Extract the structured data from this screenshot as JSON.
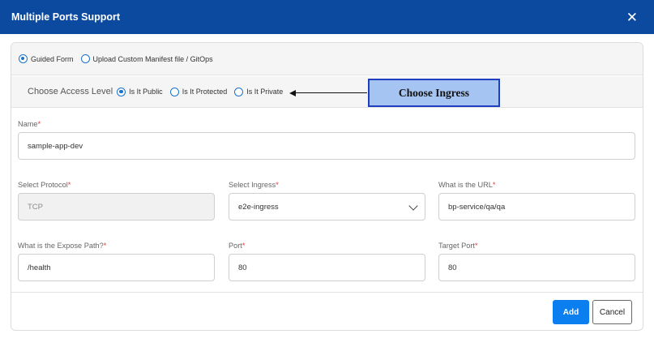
{
  "dialog": {
    "title": "Multiple Ports Support",
    "close_symbol": "✕"
  },
  "mode_options": [
    {
      "label": "Guided Form",
      "checked": true
    },
    {
      "label": "Upload Custom Manifest file / GitOps",
      "checked": false
    }
  ],
  "access": {
    "label": "Choose Access Level",
    "options": [
      {
        "label": "Is It Public",
        "checked": true
      },
      {
        "label": "Is It Protected",
        "checked": false
      },
      {
        "label": "Is It Private",
        "checked": false
      }
    ]
  },
  "annotation": {
    "text": "Choose Ingress"
  },
  "fields": {
    "name": {
      "label": "Name",
      "required_mark": "*",
      "value": "sample-app-dev"
    },
    "protocol": {
      "label": "Select Protocol",
      "required_mark": "*",
      "value": "TCP"
    },
    "ingress": {
      "label": "Select Ingress",
      "required_mark": "*",
      "value": "e2e-ingress"
    },
    "url": {
      "label": "What is the URL",
      "required_mark": "*",
      "value": "bp-service/qa/qa"
    },
    "expose_path": {
      "label": "What is the Expose Path?",
      "required_mark": "*",
      "value": "/health"
    },
    "port": {
      "label": "Port",
      "required_mark": "*",
      "value": "80"
    },
    "target_port": {
      "label": "Target Port",
      "required_mark": "*",
      "value": "80"
    }
  },
  "buttons": {
    "add": "Add",
    "cancel": "Cancel"
  },
  "colors": {
    "header": "#0c4aa0",
    "accent": "#1a73c9",
    "primary_button": "#0b7ff0",
    "callout_fill": "#a6c4f1",
    "callout_border": "#1f3fbf",
    "required": "#e53935"
  }
}
